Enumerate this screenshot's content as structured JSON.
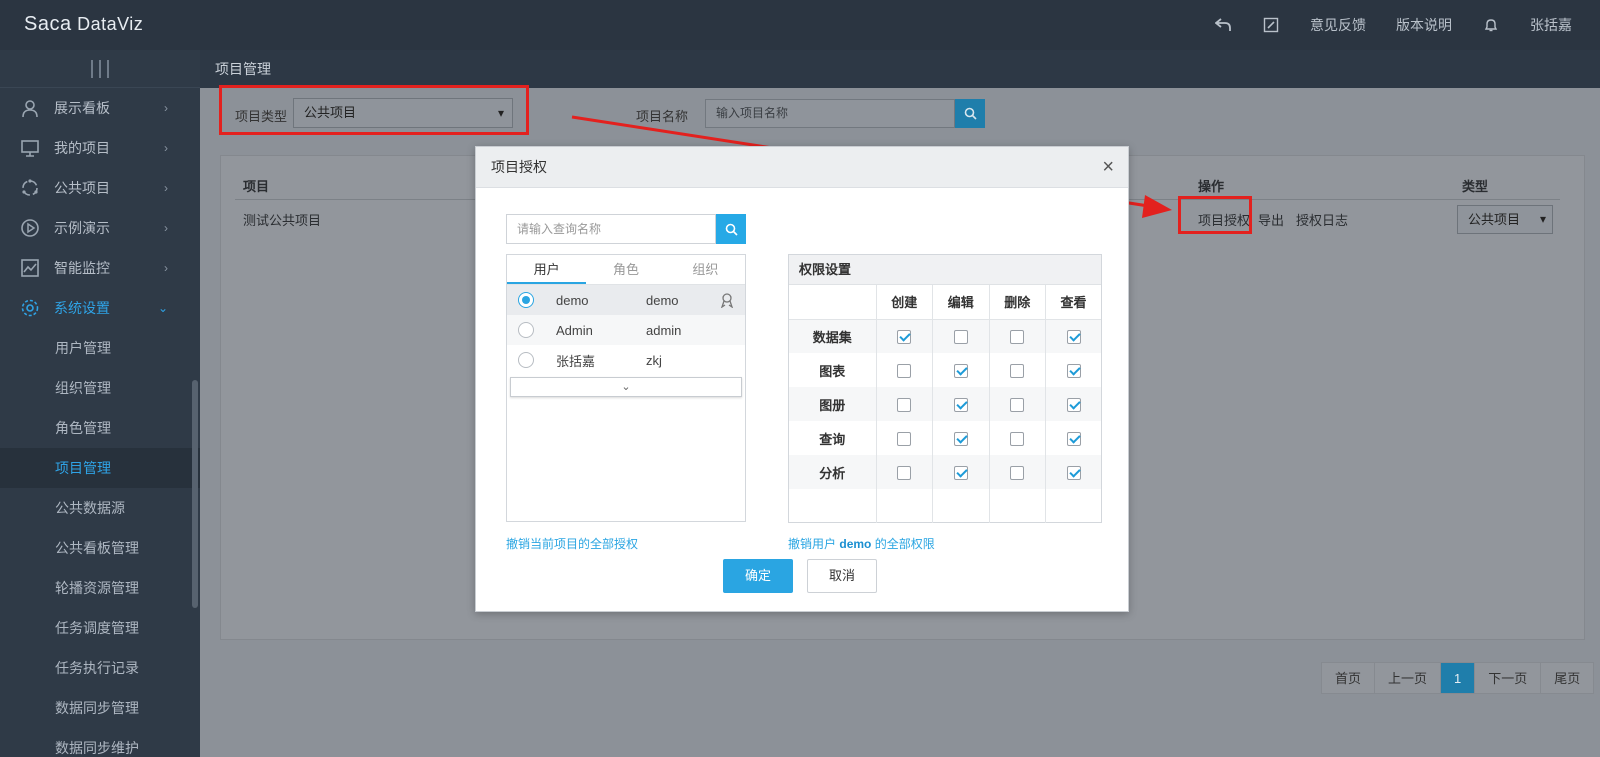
{
  "app": {
    "logo_a": "Sa",
    "logo_b": "ca",
    "logo_c": " DataViz"
  },
  "topbar": {
    "feedback": "意见反馈",
    "release_notes": "版本说明",
    "user": "张括嘉"
  },
  "sidebar": {
    "groups": [
      {
        "label": "展示看板"
      },
      {
        "label": "我的项目"
      },
      {
        "label": "公共项目"
      },
      {
        "label": "示例演示"
      },
      {
        "label": "智能监控"
      },
      {
        "label": "系统设置"
      }
    ],
    "sub_items": [
      {
        "label": "用户管理"
      },
      {
        "label": "组织管理"
      },
      {
        "label": "角色管理"
      },
      {
        "label": "项目管理"
      },
      {
        "label": "公共数据源"
      },
      {
        "label": "公共看板管理"
      },
      {
        "label": "轮播资源管理"
      },
      {
        "label": "任务调度管理"
      },
      {
        "label": "任务执行记录"
      },
      {
        "label": "数据同步管理"
      },
      {
        "label": "数据同步维护"
      }
    ]
  },
  "breadcrumb": "项目管理",
  "filters": {
    "type_label": "项目类型",
    "type_value": "公共项目",
    "name_label": "项目名称",
    "name_placeholder": "输入项目名称"
  },
  "table": {
    "headers": {
      "project": "项目",
      "actions": "操作",
      "type": "类型"
    },
    "row": {
      "project": "测试公共项目",
      "authorize": "项目授权",
      "export": "导出",
      "log": "授权日志",
      "type": "公共项目"
    }
  },
  "pager": {
    "first": "首页",
    "prev": "上一页",
    "current": "1",
    "next": "下一页",
    "last": "尾页"
  },
  "modal": {
    "title": "项目授权",
    "search_placeholder": "请输入查询名称",
    "tabs": [
      "用户",
      "角色",
      "组织"
    ],
    "users": [
      {
        "name": "demo",
        "login": "demo",
        "selected": true
      },
      {
        "name": "Admin",
        "login": "admin",
        "selected": false
      },
      {
        "name": "张括嘉",
        "login": "zkj",
        "selected": false
      }
    ],
    "perm_title": "权限设置",
    "perm_cols": [
      "创建",
      "编辑",
      "删除",
      "查看"
    ],
    "perm_rows": [
      {
        "label": "数据集",
        "checks": [
          true,
          false,
          false,
          true
        ]
      },
      {
        "label": "图表",
        "checks": [
          false,
          true,
          false,
          true
        ]
      },
      {
        "label": "图册",
        "checks": [
          false,
          true,
          false,
          true
        ]
      },
      {
        "label": "查询",
        "checks": [
          false,
          true,
          false,
          true
        ]
      },
      {
        "label": "分析",
        "checks": [
          false,
          true,
          false,
          true
        ]
      }
    ],
    "revoke_project": "撤销当前项目的全部授权",
    "revoke_user_prefix": "撤销用户",
    "revoke_user_name": "demo",
    "revoke_user_suffix": "的全部权限",
    "ok": "确定",
    "cancel": "取消"
  },
  "colors": {
    "accent": "#2aa5e2",
    "annotation": "#e3211e",
    "sidebar": "#2f3a47"
  }
}
